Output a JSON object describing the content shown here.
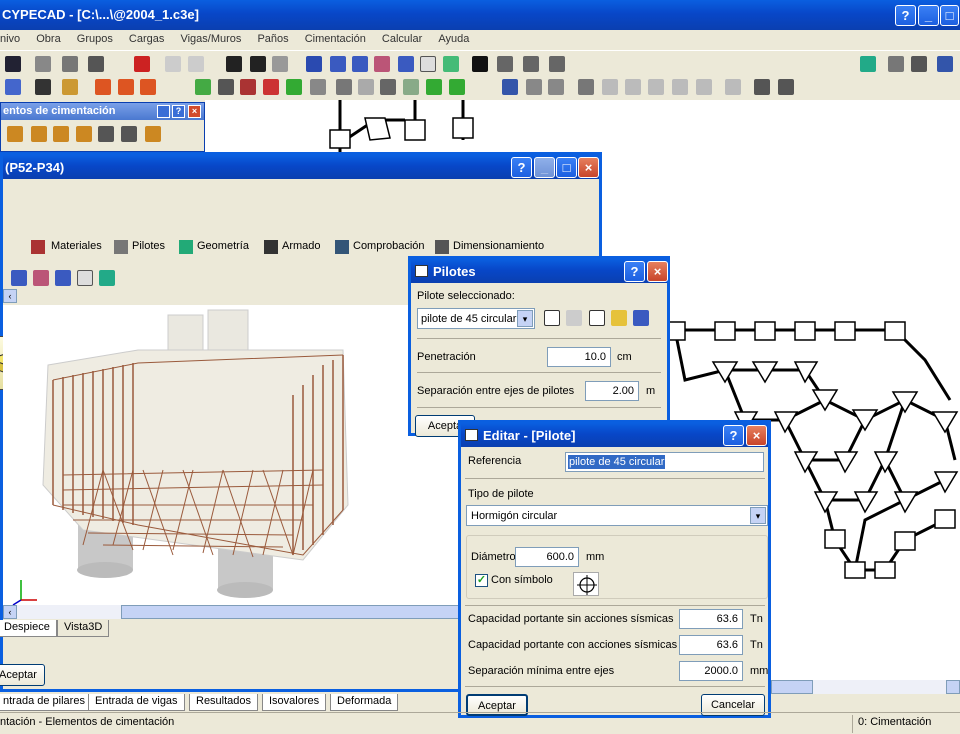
{
  "app": {
    "title": "CYPECAD - [C:\\...\\@2004_1.c3e]"
  },
  "menu": [
    "nivo",
    "Obra",
    "Grupos",
    "Cargas",
    "Vigas/Muros",
    "Paños",
    "Cimentación",
    "Calcular",
    "Ayuda"
  ],
  "elements_panel": {
    "title": "entos de cimentación"
  },
  "pile_cap_window": {
    "title": "(P52-P34)",
    "tabs": [
      "Materiales",
      "Pilotes",
      "Geometría",
      "Armado",
      "Comprobación",
      "Dimensionamiento"
    ],
    "bottom_tabs": [
      "Despiece",
      "Vista3D"
    ],
    "accept": "Aceptar"
  },
  "pilotes_dialog": {
    "title": "Pilotes",
    "selected_label": "Pilote seleccionado:",
    "selected_value": "pilote de 45 circular",
    "penetracion_label": "Penetración",
    "penetracion_value": "10.0",
    "penetracion_unit": "cm",
    "separacion_label": "Separación entre ejes de pilotes",
    "separacion_value": "2.00",
    "separacion_unit": "m",
    "accept": "Acepta"
  },
  "editar_dialog": {
    "title": "Editar - [Pilote]",
    "referencia_label": "Referencia",
    "referencia_value": "pilote de 45 circular",
    "tipo_label": "Tipo de pilote",
    "tipo_value": "Hormigón circular",
    "diametro_label": "Diámetro",
    "diametro_value": "600.0",
    "diametro_unit": "mm",
    "simbolo_label": "Con símbolo",
    "cap_sin_label": "Capacidad portante sin acciones sísmicas",
    "cap_sin_value": "63.6",
    "cap_sin_unit": "Tn",
    "cap_con_label": "Capacidad portante con acciones sísmicas",
    "cap_con_value": "63.6",
    "cap_con_unit": "Tn",
    "sep_min_label": "Separación mínima entre ejes",
    "sep_min_value": "2000.0",
    "sep_min_unit": "mm",
    "accept": "Aceptar",
    "cancel": "Cancelar"
  },
  "main_tabs": [
    "ntrada de pilares",
    "Entrada de vigas",
    "Resultados",
    "Isovalores",
    "Deformada"
  ],
  "status": {
    "left": "ntación - Elementos de cimentación",
    "right": "0: Cimentación"
  }
}
